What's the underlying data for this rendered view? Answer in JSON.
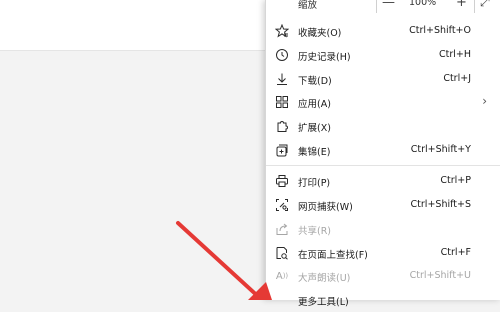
{
  "zoom": {
    "label": "缩放",
    "minus": "—",
    "value": "100%",
    "plus": "+",
    "expand": "⤢"
  },
  "items": [
    {
      "label": "收藏夹(O)",
      "shortcut": "Ctrl+Shift+O",
      "icon": "favorites-icon"
    },
    {
      "label": "历史记录(H)",
      "shortcut": "Ctrl+H",
      "icon": "history-icon"
    },
    {
      "label": "下载(D)",
      "shortcut": "Ctrl+J",
      "icon": "download-icon"
    },
    {
      "label": "应用(A)",
      "shortcut": "",
      "icon": "apps-icon"
    },
    {
      "label": "扩展(X)",
      "shortcut": "",
      "icon": "extensions-icon"
    },
    {
      "label": "集锦(E)",
      "shortcut": "Ctrl+Shift+Y",
      "icon": "collections-icon"
    },
    {
      "label": "打印(P)",
      "shortcut": "Ctrl+P",
      "icon": "print-icon"
    },
    {
      "label": "网页捕获(W)",
      "shortcut": "Ctrl+Shift+S",
      "icon": "web-capture-icon"
    },
    {
      "label": "共享(R)",
      "shortcut": "",
      "icon": "share-icon"
    },
    {
      "label": "在页面上查找(F)",
      "shortcut": "Ctrl+F",
      "icon": "find-icon"
    },
    {
      "label": "大声朗读(U)",
      "shortcut": "Ctrl+Shift+U",
      "icon": "read-aloud-icon"
    },
    {
      "label": "更多工具(L)",
      "shortcut": "",
      "icon": "more-tools-icon"
    }
  ],
  "colors": {
    "arrow": "#e53935"
  }
}
